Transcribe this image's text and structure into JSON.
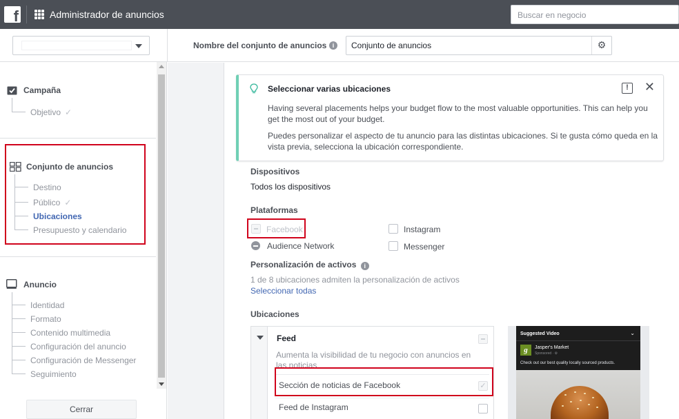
{
  "topbar": {
    "logo_letter": "f",
    "app_title": "Administrador de anuncios",
    "search_placeholder": "Buscar en negocio"
  },
  "header": {
    "name_label": "Nombre del conjunto de anuncios",
    "name_value": "Conjunto de anuncios"
  },
  "sidebar": {
    "campaign": {
      "title": "Campaña",
      "steps": [
        "Objetivo"
      ]
    },
    "adset": {
      "title": "Conjunto de anuncios",
      "steps": [
        "Destino",
        "Público",
        "Ubicaciones",
        "Presupuesto y calendario"
      ],
      "active_step": "Ubicaciones"
    },
    "ad": {
      "title": "Anuncio",
      "steps": [
        "Identidad",
        "Formato",
        "Contenido multimedia",
        "Configuración del anuncio",
        "Configuración de Messenger",
        "Seguimiento"
      ]
    },
    "close_label": "Cerrar"
  },
  "tip": {
    "title": "Seleccionar varias ubicaciones",
    "p1": "Having several placements helps your budget flow to the most valuable opportunities. This can help you get the most out of your budget.",
    "p2": "Puedes personalizar el aspecto de tu anuncio para las distintas ubicaciones. Si te gusta cómo queda en la vista previa, selecciona la ubicación correspondiente."
  },
  "devices": {
    "label": "Dispositivos",
    "value": "Todos los dispositivos"
  },
  "platforms": {
    "label": "Plataformas",
    "items": [
      "Facebook",
      "Audience Network",
      "Instagram",
      "Messenger"
    ]
  },
  "asset_custom": {
    "label": "Personalización de activos",
    "note": "1 de 8 ubicaciones admiten la personalización de activos",
    "select_all": "Seleccionar todas"
  },
  "placements": {
    "label": "Ubicaciones",
    "group": "Feed",
    "group_desc": "Aumenta la visibilidad de tu negocio con anuncios en las noticias",
    "items": [
      "Sección de noticias de Facebook",
      "Feed de Instagram"
    ]
  },
  "preview": {
    "header": "Suggested Video",
    "advertiser": "Jasper's Market",
    "sponsored": "Sponsored · ⚙",
    "logo_letter": "g",
    "description": "Check out our best quality locally sourced products."
  },
  "colors": {
    "accent": "#4267b2",
    "highlight_box": "#d0021b",
    "tip_border": "#70d0b5",
    "topbar": "#4b4f56"
  }
}
